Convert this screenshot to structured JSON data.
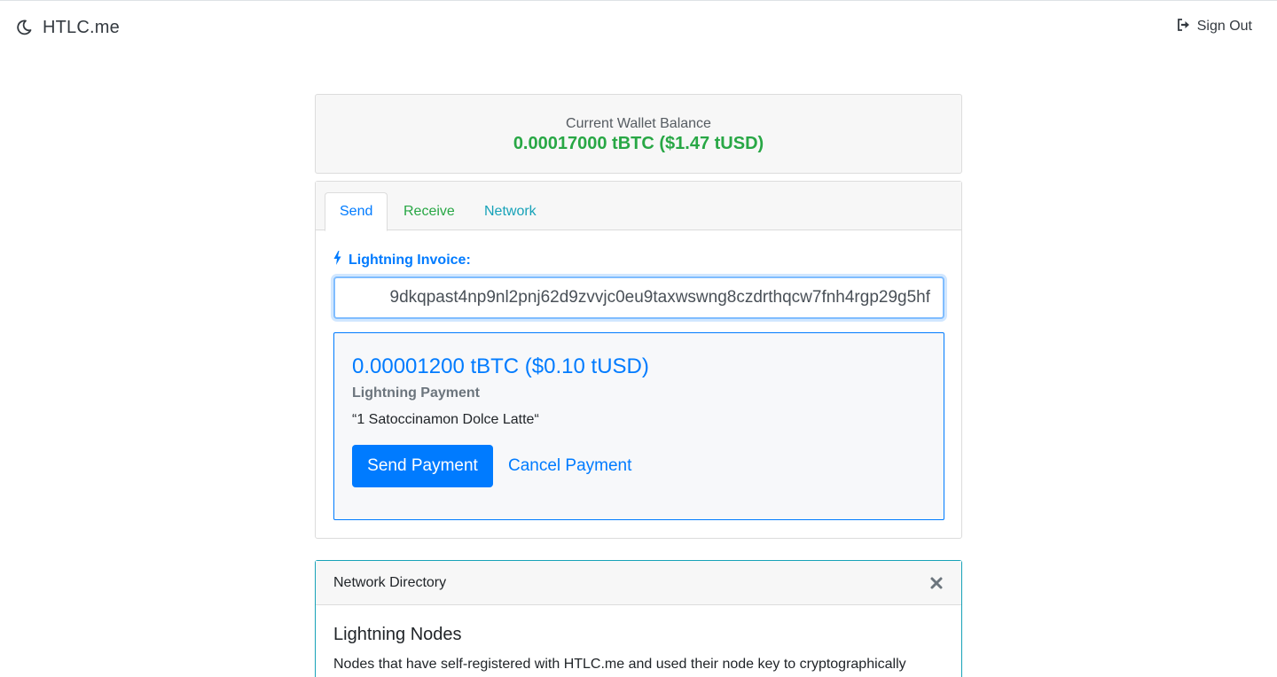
{
  "nav": {
    "brand": "HTLC.me",
    "brand_icon": "moon-icon",
    "signout_label": "Sign Out",
    "signout_icon": "sign-out-icon"
  },
  "balance": {
    "label": "Current Wallet Balance",
    "value": "0.00017000 tBTC ($1.47 tUSD)",
    "color": "#28a745"
  },
  "tabs": [
    {
      "label": "Send",
      "active": true,
      "color": "#007bff"
    },
    {
      "label": "Receive",
      "active": false,
      "color": "#28a745"
    },
    {
      "label": "Network",
      "active": false,
      "color": "#17a2b8"
    }
  ],
  "send": {
    "invoice_label": "Lightning Invoice:",
    "invoice_icon": "bolt-icon",
    "invoice_value": "9dkqpast4np9nl2pnj62d9zvvjc0eu9taxwswng8czdrthqcw7fnh4rgp29g5hf",
    "payment": {
      "amount": "0.00001200 tBTC ($0.10 tUSD)",
      "type": "Lightning Payment",
      "description": "“1 Satoccinamon Dolce Latte“",
      "send_label": "Send Payment",
      "cancel_label": "Cancel Payment"
    }
  },
  "directory": {
    "title": "Network Directory",
    "close_icon": "close-icon",
    "section_title": "Lightning Nodes",
    "section_text": "Nodes that have self-registered with HTLC.me and used their node key to cryptographically"
  },
  "colors": {
    "primary": "#007bff",
    "success": "#28a745",
    "info": "#17a2b8"
  }
}
